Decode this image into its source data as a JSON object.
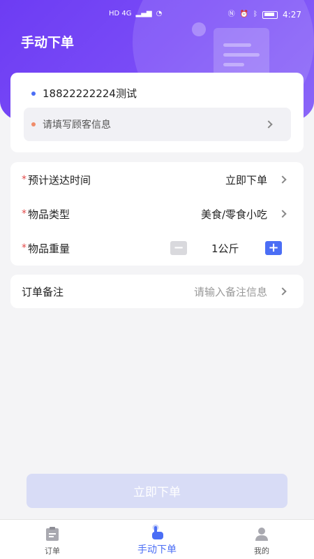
{
  "status_bar": {
    "network": "HD 4G",
    "time": "4:27"
  },
  "header": {
    "title": "手动下单"
  },
  "customer": {
    "phone": "18822222224测试",
    "customer_info_placeholder": "请填写顾客信息"
  },
  "form": {
    "delivery_time": {
      "required_mark": "*",
      "label": "预计送达时间",
      "value": "立即下单"
    },
    "item_type": {
      "required_mark": "*",
      "label": "物品类型",
      "value": "美食/零食小吃"
    },
    "item_weight": {
      "required_mark": "*",
      "label": "物品重量",
      "value": "1公斤",
      "minus": "−",
      "plus": "+"
    }
  },
  "remark": {
    "label": "订单备注",
    "placeholder": "请输入备注信息"
  },
  "submit": {
    "label": "立即下单"
  },
  "tabbar": {
    "tabs": [
      {
        "label": "订单",
        "icon": "clipboard-icon"
      },
      {
        "label": "手动下单",
        "icon": "tap-hand-icon",
        "active": true
      },
      {
        "label": "我的",
        "icon": "user-icon"
      }
    ]
  },
  "colors": {
    "header_gradient_start": "#6d3cf3",
    "accent": "#4b6ef5",
    "required": "#e24a4a",
    "submit_disabled": "#d8dcf6"
  }
}
